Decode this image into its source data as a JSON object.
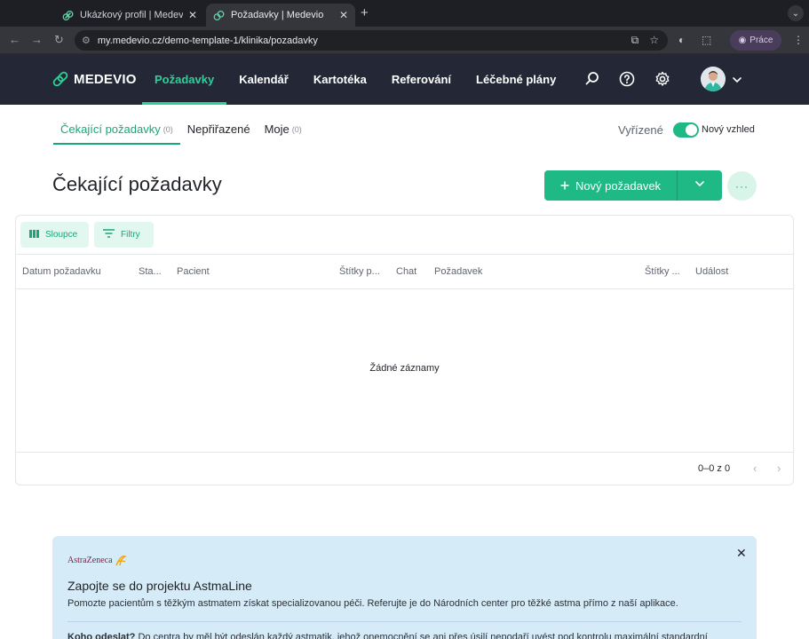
{
  "browser": {
    "tabs": [
      {
        "title": "Ukázkový profil | Medevio",
        "active": false
      },
      {
        "title": "Požadavky | Medevio",
        "active": true
      }
    ],
    "new_tab": "+",
    "url": "my.medevio.cz/demo-template-1/klinika/pozadavky",
    "profile_label": "Práce"
  },
  "app": {
    "logo": "MEDEVIO",
    "nav": [
      {
        "label": "Požadavky",
        "active": true
      },
      {
        "label": "Kalendář",
        "active": false
      },
      {
        "label": "Kartotéka",
        "active": false
      },
      {
        "label": "Referování",
        "active": false
      },
      {
        "label": "Léčebné plány",
        "active": false
      }
    ],
    "accent": "#1fb985"
  },
  "subtabs": [
    {
      "label": "Čekající požadavky",
      "count": "(0)",
      "active": true
    },
    {
      "label": "Nepřiřazené",
      "count": "",
      "active": false
    },
    {
      "label": "Moje",
      "count": "(0)",
      "active": false
    }
  ],
  "resolved_label": "Vyřízené",
  "new_look_label": "Nový vzhled",
  "new_look_on": true,
  "page_title": "Čekající požadavky",
  "new_request_label": "Nový požadavek",
  "toolbar": {
    "columns_label": "Sloupce",
    "filters_label": "Filtry"
  },
  "table": {
    "headers": [
      "Datum požadavku",
      "Sta...",
      "Pacient",
      "Štítky p...",
      "Chat",
      "Požadavek",
      "Štítky ...",
      "Událost"
    ],
    "empty_text": "Žádné záznamy",
    "pagination": "0–0 z 0"
  },
  "banner": {
    "brand": "AstraZeneca",
    "title": "Zapojte se do projektu AstmaLine",
    "subtitle": "Pomozte pacientům s těžkým astmatem získat specializovanou péči. Referujte je do Národních center pro těžké astma přímo z naší aplikace.",
    "more_label": "Koho odeslat?",
    "more_text": "Do centra by měl být odeslán každý astmatik, jehož onemocnění se ani přes úsilí nepodaří uvést pod kontrolu maximální standardní"
  }
}
